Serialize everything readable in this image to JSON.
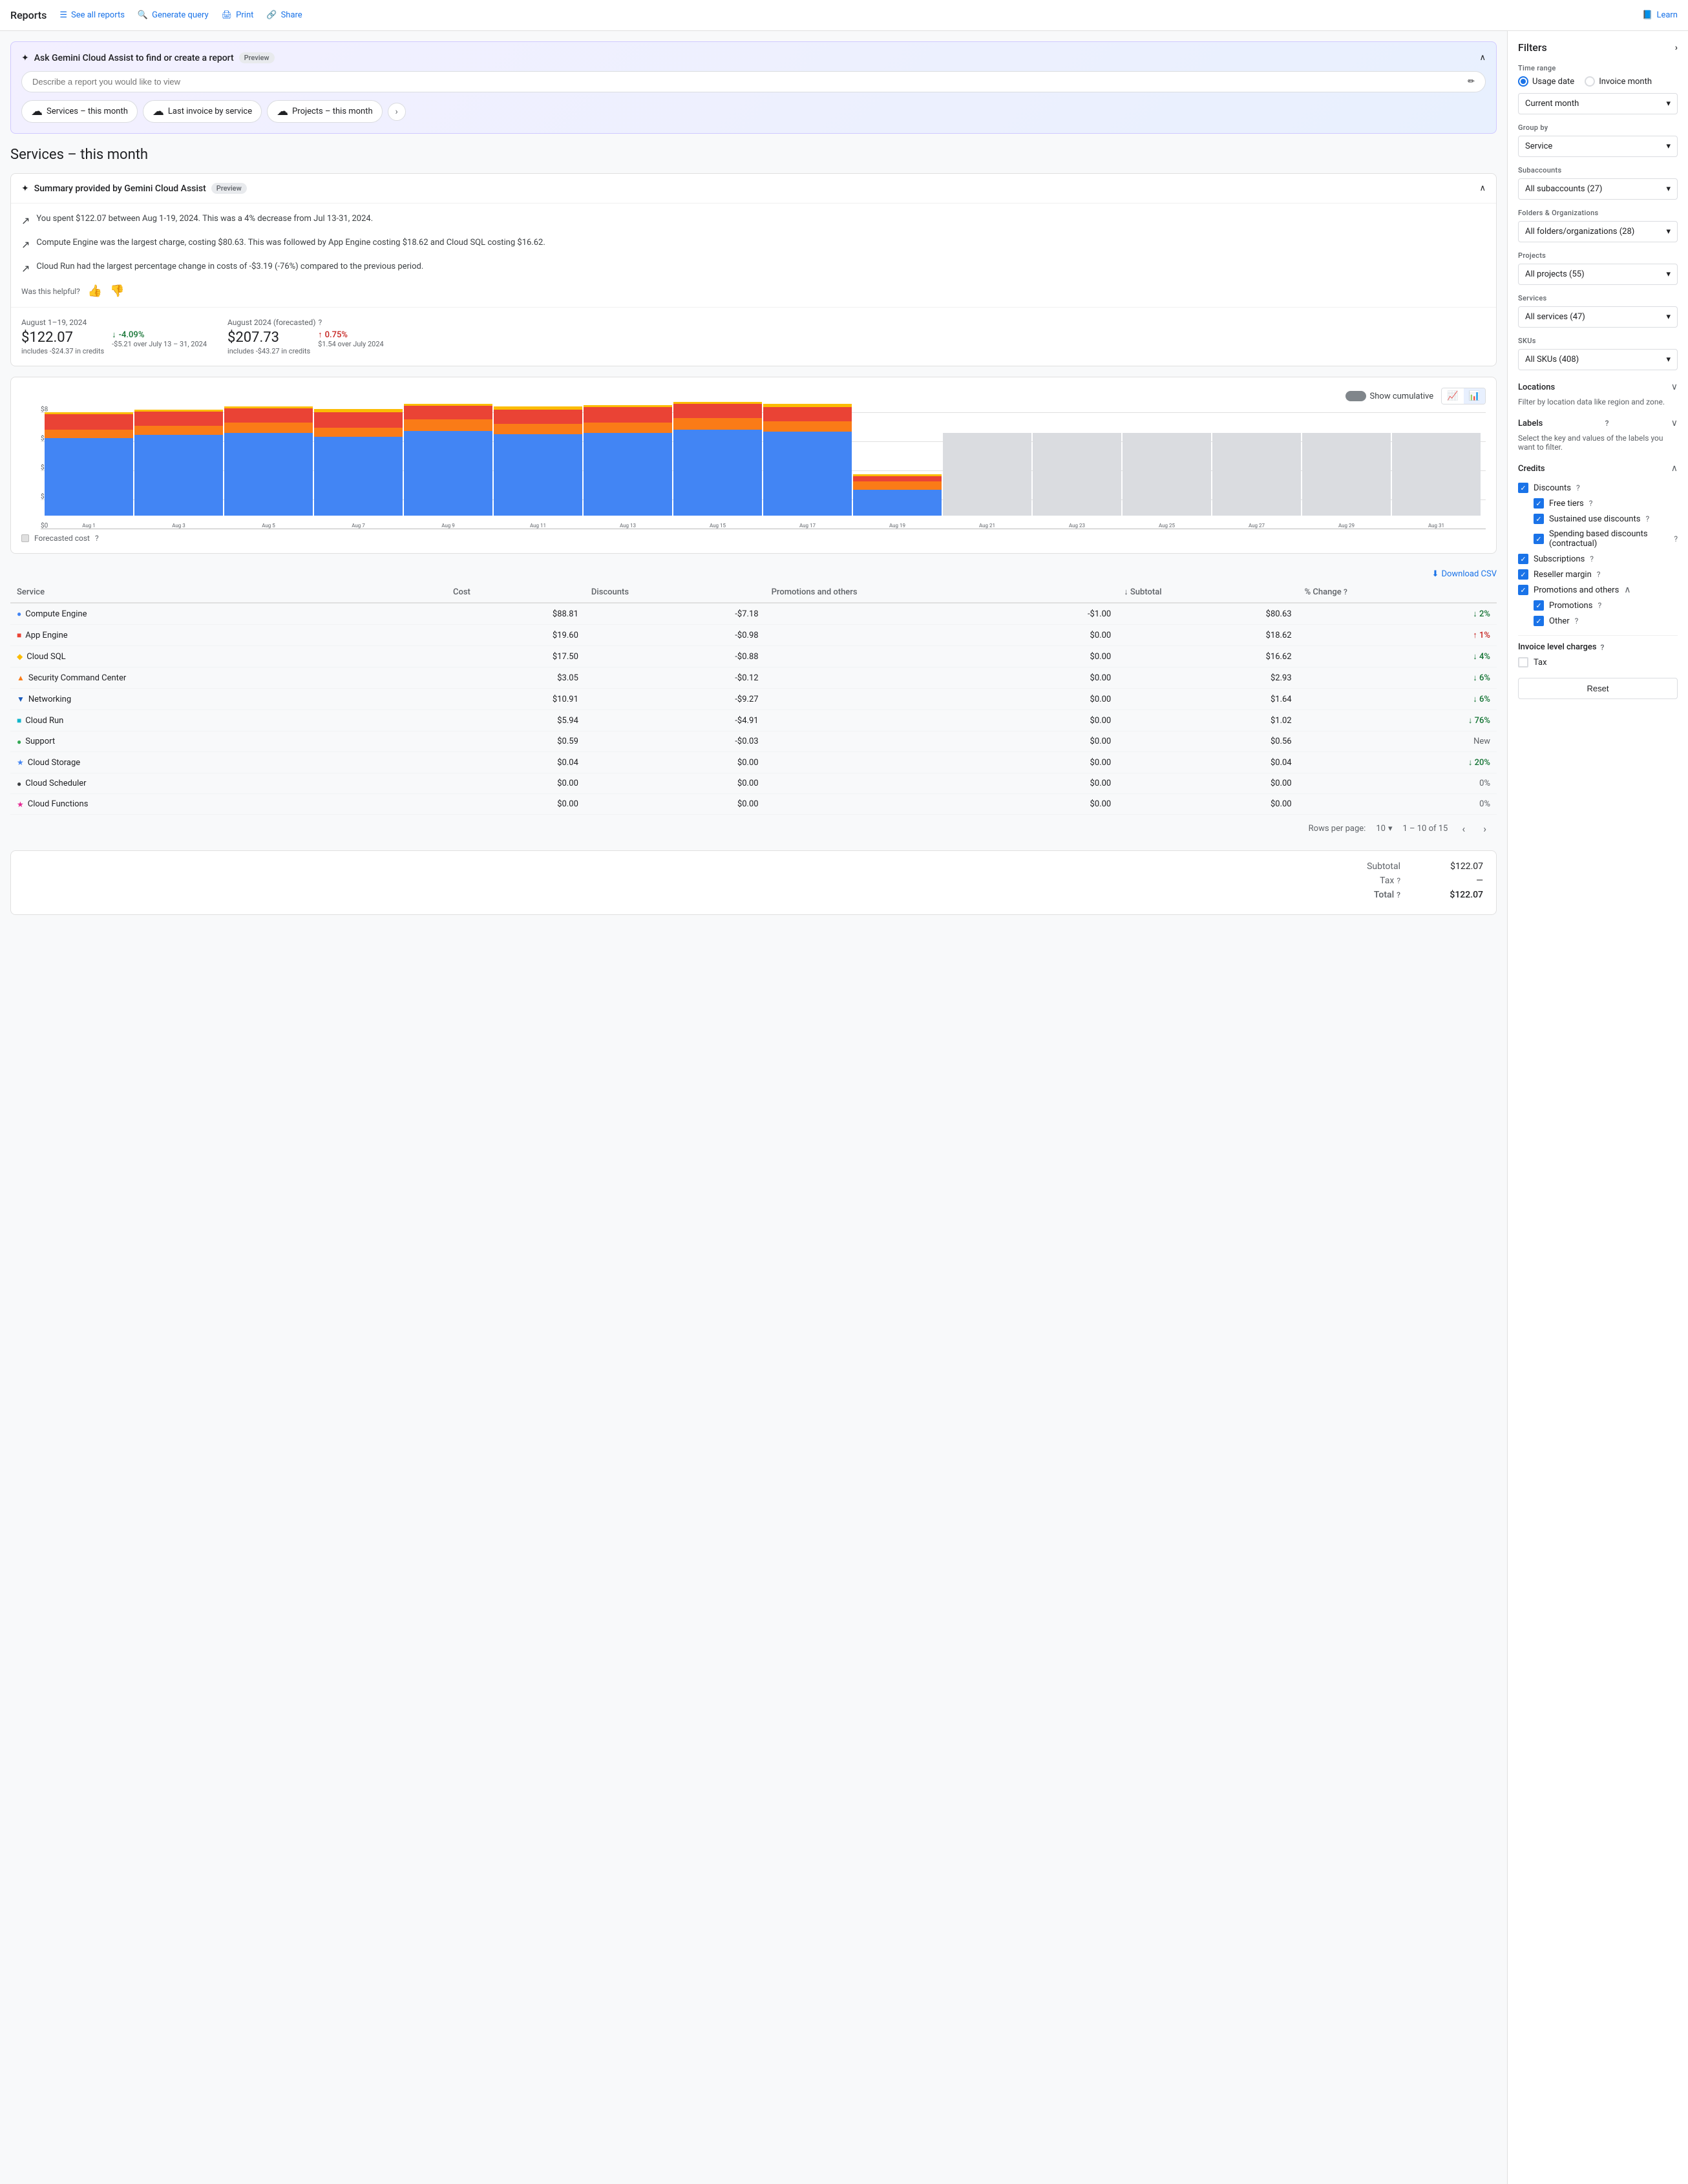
{
  "nav": {
    "title": "Reports",
    "links": [
      {
        "label": "See all reports",
        "icon": "☰"
      },
      {
        "label": "Generate query",
        "icon": "🔍"
      },
      {
        "label": "Print",
        "icon": "🖨"
      },
      {
        "label": "Share",
        "icon": "🔗"
      },
      {
        "label": "Learn",
        "icon": "📘"
      }
    ]
  },
  "gemini": {
    "title": "Ask Gemini Cloud Assist to find or create a report",
    "badge": "Preview",
    "placeholder": "Describe a report you would like to view",
    "chips": [
      {
        "label": "Services – this month"
      },
      {
        "label": "Last invoice by service"
      },
      {
        "label": "Projects – this month"
      }
    ]
  },
  "page": {
    "title": "Services – this month"
  },
  "summary": {
    "title": "Summary provided by Gemini Cloud Assist",
    "badge": "Preview",
    "items": [
      "You spent $122.07 between Aug 1-19, 2024. This was a 4% decrease from Jul 13-31, 2024.",
      "Compute Engine was the largest charge, costing $80.63. This was followed by App Engine costing $18.62 and Cloud SQL costing $16.62.",
      "Cloud Run had the largest percentage change in costs of -$3.19 (-76%) compared to the previous period."
    ],
    "feedback_label": "Was this helpful?"
  },
  "stats": {
    "current": {
      "period": "August 1–19, 2024",
      "amount": "$122.07",
      "credits": "includes -$24.37 in credits",
      "change": "-4.09%",
      "change_desc": "-$5.21 over July 13 – 31, 2024",
      "change_dir": "down"
    },
    "forecasted": {
      "period": "August 2024 (forecasted)",
      "amount": "$207.73",
      "credits": "includes -$43.27 in credits",
      "change": "0.75%",
      "change_desc": "$1.54 over July 2024",
      "change_dir": "up"
    }
  },
  "chart": {
    "y_max": "$8",
    "y_labels": [
      "$8",
      "$6",
      "$4",
      "$2",
      "$0"
    ],
    "cumulative_label": "Show cumulative",
    "download_label": "Download CSV",
    "legend_label": "Forecasted cost",
    "bars": [
      {
        "label": "Aug 1",
        "compute": 75,
        "sql": 15,
        "app": 8,
        "other": 2
      },
      {
        "label": "Aug 3",
        "compute": 78,
        "sql": 14,
        "app": 9,
        "other": 2
      },
      {
        "label": "Aug 5",
        "compute": 80,
        "sql": 14,
        "app": 10,
        "other": 2
      },
      {
        "label": "Aug 7",
        "compute": 76,
        "sql": 15,
        "app": 9,
        "other": 3
      },
      {
        "label": "Aug 9",
        "compute": 82,
        "sql": 13,
        "app": 11,
        "other": 2
      },
      {
        "label": "Aug 11",
        "compute": 79,
        "sql": 14,
        "app": 10,
        "other": 3
      },
      {
        "label": "Aug 13",
        "compute": 80,
        "sql": 15,
        "app": 10,
        "other": 2
      },
      {
        "label": "Aug 15",
        "compute": 83,
        "sql": 14,
        "app": 11,
        "other": 2
      },
      {
        "label": "Aug 17",
        "compute": 81,
        "sql": 14,
        "app": 10,
        "other": 3
      },
      {
        "label": "Aug 19",
        "compute": 25,
        "sql": 5,
        "app": 8,
        "other": 2
      },
      {
        "label": "Aug 21",
        "compute": 0,
        "sql": 0,
        "app": 0,
        "other": 0,
        "forecast": 80
      },
      {
        "label": "Aug 23",
        "compute": 0,
        "sql": 0,
        "app": 0,
        "other": 0,
        "forecast": 80
      },
      {
        "label": "Aug 25",
        "compute": 0,
        "sql": 0,
        "app": 0,
        "other": 0,
        "forecast": 80
      },
      {
        "label": "Aug 27",
        "compute": 0,
        "sql": 0,
        "app": 0,
        "other": 0,
        "forecast": 80
      },
      {
        "label": "Aug 29",
        "compute": 0,
        "sql": 0,
        "app": 0,
        "other": 0,
        "forecast": 80
      },
      {
        "label": "Aug 31",
        "compute": 0,
        "sql": 0,
        "app": 0,
        "other": 0,
        "forecast": 80
      }
    ]
  },
  "table": {
    "headers": [
      "Service",
      "Cost",
      "Discounts",
      "Promotions and others",
      "Subtotal ↓",
      "% Change"
    ],
    "rows": [
      {
        "icon": "dot",
        "color": "#4285f4",
        "shape": "circle",
        "service": "Compute Engine",
        "cost": "$88.81",
        "discounts": "-$7.18",
        "promo": "-$1.00",
        "subtotal": "$80.63",
        "pct": "2%",
        "pct_dir": "down"
      },
      {
        "icon": "dot",
        "color": "#ea4335",
        "shape": "square",
        "service": "App Engine",
        "cost": "$19.60",
        "discounts": "-$0.98",
        "promo": "$0.00",
        "subtotal": "$18.62",
        "pct": "1%",
        "pct_dir": "up"
      },
      {
        "icon": "dot",
        "color": "#fbbc04",
        "shape": "diamond",
        "service": "Cloud SQL",
        "cost": "$17.50",
        "discounts": "-$0.88",
        "promo": "$0.00",
        "subtotal": "$16.62",
        "pct": "4%",
        "pct_dir": "down"
      },
      {
        "icon": "dot",
        "color": "#fa7b17",
        "shape": "triangle",
        "service": "Security Command Center",
        "cost": "$3.05",
        "discounts": "-$0.12",
        "promo": "$0.00",
        "subtotal": "$2.93",
        "pct": "6%",
        "pct_dir": "down"
      },
      {
        "icon": "dot",
        "color": "#185abc",
        "shape": "triangle-down",
        "service": "Networking",
        "cost": "$10.91",
        "discounts": "-$9.27",
        "promo": "$0.00",
        "subtotal": "$1.64",
        "pct": "6%",
        "pct_dir": "down"
      },
      {
        "icon": "dot",
        "color": "#12b5cb",
        "shape": "square",
        "service": "Cloud Run",
        "cost": "$5.94",
        "discounts": "-$4.91",
        "promo": "$0.00",
        "subtotal": "$1.02",
        "pct": "76%",
        "pct_dir": "down"
      },
      {
        "icon": "dot",
        "color": "#34a853",
        "shape": "circle-outline",
        "service": "Support",
        "cost": "$0.59",
        "discounts": "-$0.03",
        "promo": "$0.00",
        "subtotal": "$0.56",
        "pct": "New",
        "pct_dir": "neutral"
      },
      {
        "icon": "dot",
        "color": "#4285f4",
        "shape": "star",
        "service": "Cloud Storage",
        "cost": "$0.04",
        "discounts": "$0.00",
        "promo": "$0.00",
        "subtotal": "$0.04",
        "pct": "20%",
        "pct_dir": "down"
      },
      {
        "icon": "dot",
        "color": "#3c4043",
        "shape": "circle",
        "service": "Cloud Scheduler",
        "cost": "$0.00",
        "discounts": "$0.00",
        "promo": "$0.00",
        "subtotal": "$0.00",
        "pct": "0%",
        "pct_dir": "neutral"
      },
      {
        "icon": "dot",
        "color": "#e52592",
        "shape": "star",
        "service": "Cloud Functions",
        "cost": "$0.00",
        "discounts": "$0.00",
        "promo": "$0.00",
        "subtotal": "$0.00",
        "pct": "0%",
        "pct_dir": "neutral"
      }
    ],
    "pagination": {
      "rows_per_page_label": "Rows per page:",
      "rows_per_page": "10",
      "range": "1 – 10 of 15"
    }
  },
  "totals": {
    "subtotal_label": "Subtotal",
    "subtotal_value": "$122.07",
    "tax_label": "Tax",
    "tax_value": "—",
    "total_label": "Total",
    "total_value": "$122.07"
  },
  "filters": {
    "title": "Filters",
    "time_range_label": "Time range",
    "radio_usage": "Usage date",
    "radio_invoice": "Invoice month",
    "current_month": "Current month",
    "group_by_label": "Group by",
    "group_by_value": "Service",
    "subaccounts_label": "Subaccounts",
    "subaccounts_value": "All subaccounts (27)",
    "folders_label": "Folders & Organizations",
    "folders_value": "All folders/organizations (28)",
    "projects_label": "Projects",
    "projects_value": "All projects (55)",
    "services_label": "Services",
    "services_value": "All services (47)",
    "skus_label": "SKUs",
    "skus_value": "All SKUs (408)",
    "locations_label": "Locations",
    "locations_desc": "Filter by location data like region and zone.",
    "labels_label": "Labels",
    "labels_desc": "Select the key and values of the labels you want to filter.",
    "credits_label": "Credits",
    "discounts_label": "Discounts",
    "free_tiers": "Free tiers",
    "sustained_use": "Sustained use discounts",
    "spending_based": "Spending based discounts (contractual)",
    "subscriptions": "Subscriptions",
    "reseller_margin": "Reseller margin",
    "promotions_others": "Promotions and others",
    "promotions": "Promotions",
    "other": "Other",
    "invoice_charges_label": "Invoice level charges",
    "tax_label_filter": "Tax",
    "reset_label": "Reset"
  }
}
